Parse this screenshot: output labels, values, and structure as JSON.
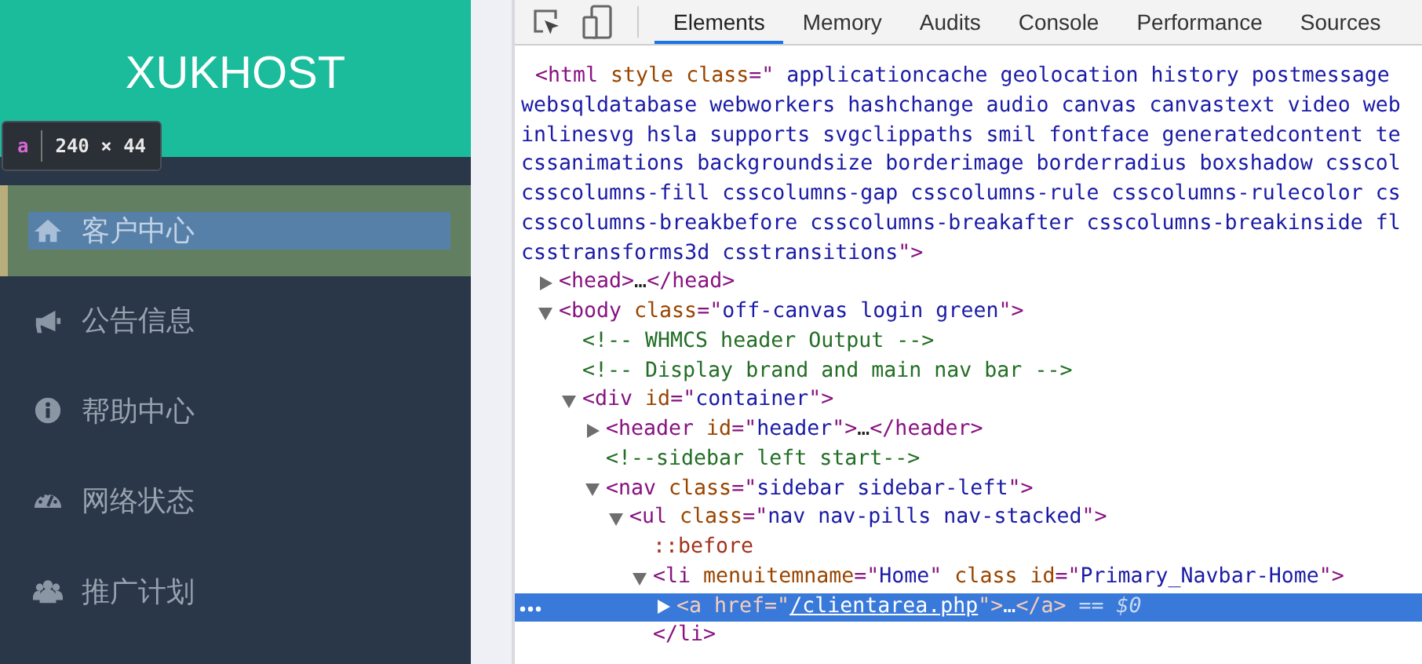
{
  "site": {
    "title": "XUKHOST",
    "tooltip": {
      "tag": "a",
      "size": "240 × 44"
    }
  },
  "sidebar": {
    "items": [
      {
        "kind": "home",
        "label": "客户中心",
        "selected": true
      },
      {
        "kind": "bullhorn",
        "label": "公告信息",
        "selected": false
      },
      {
        "kind": "info",
        "label": "帮助中心",
        "selected": false
      },
      {
        "kind": "gauge",
        "label": "网络状态",
        "selected": false
      },
      {
        "kind": "users",
        "label": "推广计划",
        "selected": false
      }
    ]
  },
  "devtools": {
    "tabs": [
      {
        "label": "Elements",
        "selected": true
      },
      {
        "label": "Memory",
        "selected": false
      },
      {
        "label": "Audits",
        "selected": false
      },
      {
        "label": "Console",
        "selected": false
      },
      {
        "label": "Performance",
        "selected": false
      },
      {
        "label": "Sources",
        "selected": false
      }
    ],
    "tree": [
      {
        "selected": false,
        "lines": [
          [
            {
              "kind": "tag",
              "text": "<html"
            },
            {
              "kind": "attr",
              "text": " style class"
            },
            {
              "kind": "tag",
              "text": "=\""
            },
            {
              "kind": "value",
              "text": " applicationcache geolocation history postmessage"
            }
          ],
          [
            {
              "kind": "value",
              "text": "websqldatabase webworkers hashchange audio canvas canvastext video web"
            }
          ],
          [
            {
              "kind": "value",
              "text": "inlinesvg hsla supports svgclippaths smil fontface generatedcontent te"
            }
          ],
          [
            {
              "kind": "value",
              "text": "cssanimations backgroundsize borderimage borderradius boxshadow csscol"
            }
          ],
          [
            {
              "kind": "value",
              "text": "csscolumns-fill csscolumns-gap csscolumns-rule csscolumns-rulecolor cs"
            }
          ],
          [
            {
              "kind": "value",
              "text": "csscolumns-breakbefore csscolumns-breakafter csscolumns-breakinside fl"
            }
          ],
          [
            {
              "kind": "value",
              "text": "csstransforms3d csstransitions"
            },
            {
              "kind": "tag",
              "text": "\">"
            }
          ]
        ],
        "children": [
          {
            "expanded": false,
            "selected": false,
            "lines": [
              [
                {
                  "kind": "tag",
                  "text": "<head>"
                },
                {
                  "kind": "plain",
                  "text": "…"
                },
                {
                  "kind": "tag",
                  "text": "</head>"
                }
              ]
            ]
          },
          {
            "expanded": true,
            "selected": false,
            "lines": [
              [
                {
                  "kind": "tag",
                  "text": "<body"
                },
                {
                  "kind": "attr",
                  "text": " class"
                },
                {
                  "kind": "tag",
                  "text": "=\""
                },
                {
                  "kind": "value",
                  "text": "off-canvas login green"
                },
                {
                  "kind": "tag",
                  "text": "\">"
                }
              ]
            ],
            "children": [
              {
                "selected": false,
                "lines": [
                  [
                    {
                      "kind": "comment",
                      "text": "<!-- WHMCS header Output -->"
                    }
                  ]
                ]
              },
              {
                "selected": false,
                "lines": [
                  [
                    {
                      "kind": "comment",
                      "text": "<!-- Display brand and main nav bar -->"
                    }
                  ]
                ]
              },
              {
                "expanded": true,
                "selected": false,
                "lines": [
                  [
                    {
                      "kind": "tag",
                      "text": "<div"
                    },
                    {
                      "kind": "attr",
                      "text": " id"
                    },
                    {
                      "kind": "tag",
                      "text": "=\""
                    },
                    {
                      "kind": "value",
                      "text": "container"
                    },
                    {
                      "kind": "tag",
                      "text": "\">"
                    }
                  ]
                ],
                "children": [
                  {
                    "expanded": false,
                    "selected": false,
                    "lines": [
                      [
                        {
                          "kind": "tag",
                          "text": "<header"
                        },
                        {
                          "kind": "attr",
                          "text": " id"
                        },
                        {
                          "kind": "tag",
                          "text": "=\""
                        },
                        {
                          "kind": "value",
                          "text": "header"
                        },
                        {
                          "kind": "tag",
                          "text": "\">"
                        },
                        {
                          "kind": "plain",
                          "text": "…"
                        },
                        {
                          "kind": "tag",
                          "text": "</header>"
                        }
                      ]
                    ]
                  },
                  {
                    "selected": false,
                    "lines": [
                      [
                        {
                          "kind": "comment",
                          "text": "<!--sidebar left start-->"
                        }
                      ]
                    ]
                  },
                  {
                    "expanded": true,
                    "selected": false,
                    "lines": [
                      [
                        {
                          "kind": "tag",
                          "text": "<nav"
                        },
                        {
                          "kind": "attr",
                          "text": " class"
                        },
                        {
                          "kind": "tag",
                          "text": "=\""
                        },
                        {
                          "kind": "value",
                          "text": "sidebar sidebar-left"
                        },
                        {
                          "kind": "tag",
                          "text": "\">"
                        }
                      ]
                    ],
                    "children": [
                      {
                        "expanded": true,
                        "selected": false,
                        "lines": [
                          [
                            {
                              "kind": "tag",
                              "text": "<ul"
                            },
                            {
                              "kind": "attr",
                              "text": " class"
                            },
                            {
                              "kind": "tag",
                              "text": "=\""
                            },
                            {
                              "kind": "value",
                              "text": "nav nav-pills nav-stacked"
                            },
                            {
                              "kind": "tag",
                              "text": "\">"
                            }
                          ]
                        ],
                        "children": [
                          {
                            "selected": false,
                            "lines": [
                              [
                                {
                                  "kind": "pseudo",
                                  "text": "::before"
                                }
                              ]
                            ]
                          },
                          {
                            "expanded": true,
                            "selected": false,
                            "lines": [
                              [
                                {
                                  "kind": "tag",
                                  "text": "<li"
                                },
                                {
                                  "kind": "attr",
                                  "text": " menuitemname"
                                },
                                {
                                  "kind": "tag",
                                  "text": "=\""
                                },
                                {
                                  "kind": "value",
                                  "text": "Home"
                                },
                                {
                                  "kind": "tag",
                                  "text": "\""
                                },
                                {
                                  "kind": "attr",
                                  "text": " class id"
                                },
                                {
                                  "kind": "tag",
                                  "text": "=\""
                                },
                                {
                                  "kind": "value",
                                  "text": "Primary_Navbar-Home"
                                },
                                {
                                  "kind": "tag",
                                  "text": "\">"
                                }
                              ]
                            ],
                            "close": [
                              {
                                "kind": "tag",
                                "text": "</li>"
                              }
                            ],
                            "children": [
                              {
                                "expanded": false,
                                "selected": true,
                                "lines": [
                                  [
                                    {
                                      "kind": "tag",
                                      "text": "<a"
                                    },
                                    {
                                      "kind": "attr",
                                      "text": " href"
                                    },
                                    {
                                      "kind": "tag",
                                      "text": "=\""
                                    },
                                    {
                                      "kind": "link",
                                      "text": "/clientarea.php"
                                    },
                                    {
                                      "kind": "tag",
                                      "text": "\">"
                                    },
                                    {
                                      "kind": "plain",
                                      "text": "…"
                                    },
                                    {
                                      "kind": "tag",
                                      "text": "</a>"
                                    },
                                    {
                                      "kind": "note",
                                      "text": " == $0"
                                    }
                                  ]
                                ]
                              }
                            ]
                          }
                        ]
                      }
                    ]
                  }
                ]
              }
            ]
          }
        ]
      }
    ]
  }
}
